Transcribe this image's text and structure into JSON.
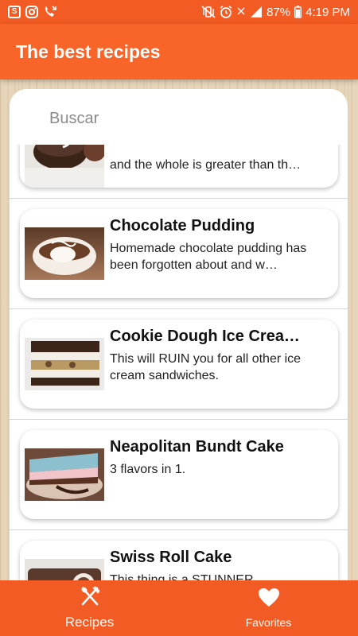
{
  "status_bar": {
    "battery": "87%",
    "time": "4:19 PM",
    "left_icons": [
      "s-app-icon",
      "instagram-icon",
      "missed-call-icon"
    ],
    "right_icons": [
      "vibrate-icon",
      "alarm-icon",
      "no-data-icon",
      "signal-icon",
      "battery-icon"
    ]
  },
  "app_bar": {
    "title": "The best recipes"
  },
  "search": {
    "placeholder": "Buscar"
  },
  "recipes": [
    {
      "title": "",
      "description": "and the whole is greater than th…"
    },
    {
      "title": "Chocolate Pudding",
      "description": "Homemade chocolate pudding has been forgotten about and w…"
    },
    {
      "title": "Cookie Dough Ice Crea…",
      "description": "This will RUIN you for all other ice cream sandwiches."
    },
    {
      "title": "Neapolitan Bundt Cake",
      "description": "3 flavors in 1."
    },
    {
      "title": "Swiss Roll Cake",
      "description": "This thing is a STUNNER"
    }
  ],
  "bottom_nav": {
    "items": [
      {
        "label": "Recipes",
        "icon": "fork-knife-icon"
      },
      {
        "label": "Favorites",
        "icon": "heart-icon"
      }
    ]
  },
  "colors": {
    "primary": "#f96429",
    "primary_dark": "#f35b24",
    "background_wood": "#e6d5b8"
  }
}
